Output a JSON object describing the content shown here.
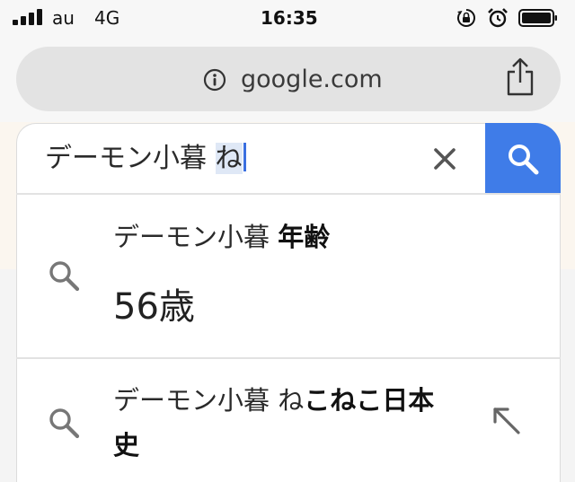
{
  "status_bar": {
    "carrier": "au",
    "network": "4G",
    "time": "16:35",
    "icons": [
      "signal-icon",
      "orientation-lock-icon",
      "alarm-icon",
      "battery-icon"
    ]
  },
  "browser": {
    "domain": "google.com",
    "icons": [
      "info-icon",
      "share-icon"
    ]
  },
  "search": {
    "query_prefix": "デーモン小暮 ",
    "query_selected": "ね",
    "icons": [
      "clear-icon",
      "search-icon"
    ],
    "accent_color": "#3f7ce8"
  },
  "suggestions": [
    {
      "prefix": "デーモン小暮 ",
      "bold": "年齢",
      "answer": "56歳"
    },
    {
      "prefix": "デーモン小暮 ね",
      "bold_line1": "こねこ日本",
      "bold_line2": "史"
    }
  ]
}
